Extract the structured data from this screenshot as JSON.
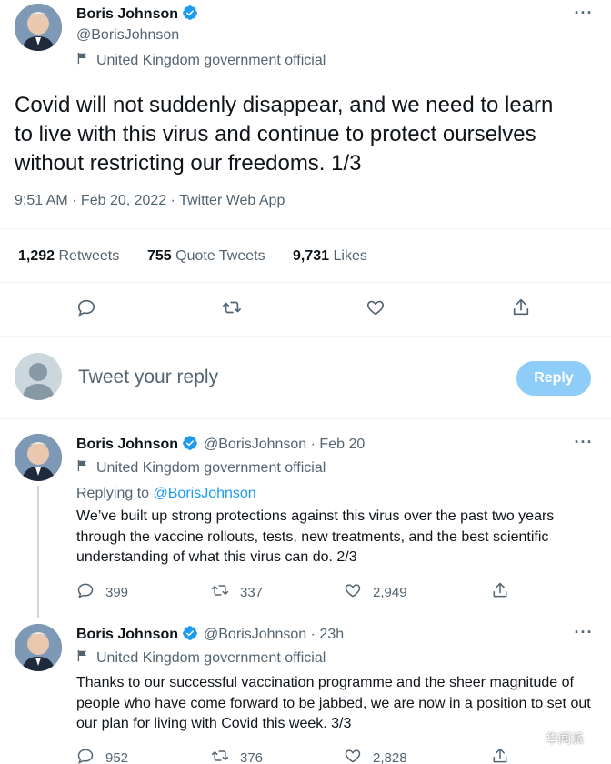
{
  "main_tweet": {
    "author_name": "Boris Johnson",
    "handle": "@BorisJohnson",
    "label": "United Kingdom government official",
    "text": "Covid will not suddenly disappear, and we need to learn to live with this virus and continue to protect ourselves without restricting our freedoms. 1/3",
    "meta": "9:51 AM · Feb 20, 2022 · Twitter Web App",
    "stats": {
      "retweets_count": "1,292",
      "retweets_label": "Retweets",
      "quotes_count": "755",
      "quotes_label": "Quote Tweets",
      "likes_count": "9,731",
      "likes_label": "Likes"
    }
  },
  "reply_box": {
    "placeholder": "Tweet your reply",
    "button_label": "Reply"
  },
  "thread": [
    {
      "author_name": "Boris Johnson",
      "handle_time": "@BorisJohnson · Feb 20",
      "label": "United Kingdom government official",
      "replying_prefix": "Replying to ",
      "replying_handle": "@BorisJohnson",
      "text": "We’ve built up strong protections against this virus over the past two years through the vaccine rollouts, tests, new treatments, and the best scientific understanding of what this virus can do. 2/3",
      "replies": "399",
      "retweets": "337",
      "likes": "2,949"
    },
    {
      "author_name": "Boris Johnson",
      "handle_time": "@BorisJohnson · 23h",
      "label": "United Kingdom government official",
      "text": "Thanks to our successful vaccination programme and the sheer magnitude of people who have come forward to be jabbed, we are now in a position to set out our plan for living with Covid this week. 3/3",
      "replies": "952",
      "retweets": "376",
      "likes": "2,828"
    }
  ],
  "watermark": "华闻派",
  "colors": {
    "accent": "#1d9bf0",
    "reply_button": "#8ecdf8",
    "secondary_text": "#536471",
    "divider": "#eff3f4"
  }
}
